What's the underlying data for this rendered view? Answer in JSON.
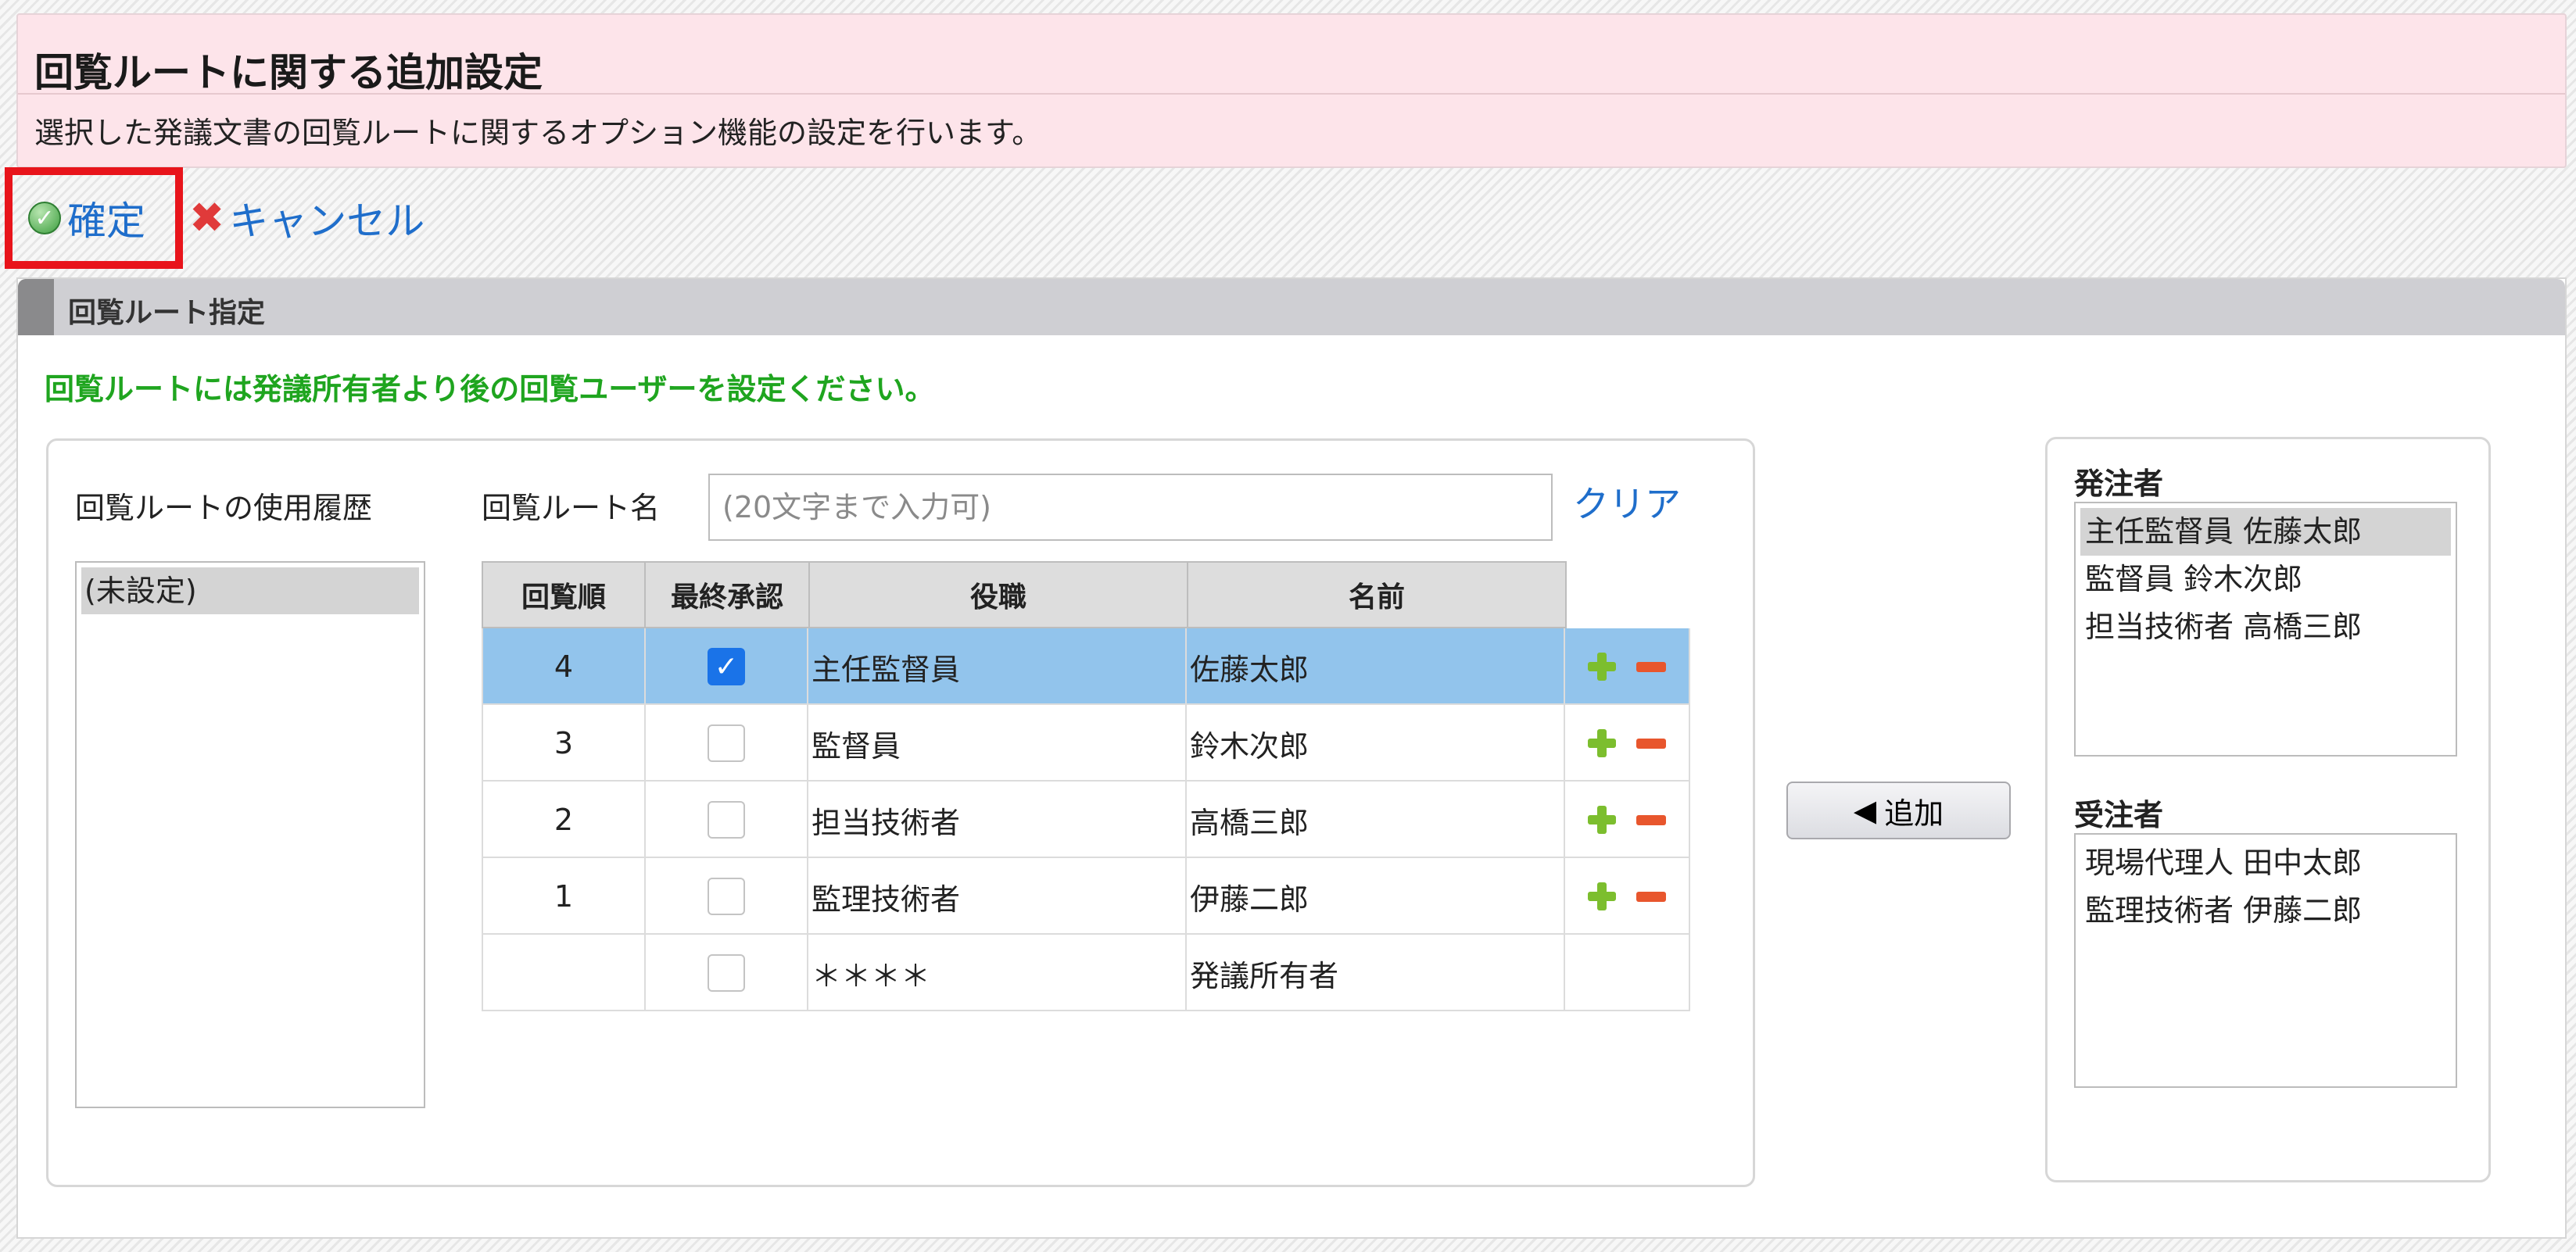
{
  "header": {
    "title": "回覧ルートに関する追加設定",
    "description": "選択した発議文書の回覧ルートに関するオプション機能の設定を行います。"
  },
  "toolbar": {
    "confirm_label": "確定",
    "cancel_label": "キャンセル"
  },
  "section": {
    "title": "回覧ルート指定",
    "notice": "回覧ルートには発議所有者より後の回覧ユーザーを設定ください。",
    "notice_color": "#1fa51f"
  },
  "history": {
    "label": "回覧ルートの使用履歴",
    "items": [
      "(未設定)"
    ]
  },
  "route_name": {
    "label": "回覧ルート名",
    "placeholder": "(20文字まで入力可)",
    "value": "",
    "clear_label": "クリア"
  },
  "table": {
    "headers": [
      "回覧順",
      "最終承認",
      "役職",
      "名前"
    ],
    "rows": [
      {
        "order": "4",
        "final": true,
        "role": "主任監督員",
        "name": "佐藤太郎",
        "selected": true,
        "actions": true
      },
      {
        "order": "3",
        "final": false,
        "role": "監督員",
        "name": "鈴木次郎",
        "selected": false,
        "actions": true
      },
      {
        "order": "2",
        "final": false,
        "role": "担当技術者",
        "name": "高橋三郎",
        "selected": false,
        "actions": true
      },
      {
        "order": "1",
        "final": false,
        "role": "監理技術者",
        "name": "伊藤二郎",
        "selected": false,
        "actions": true
      },
      {
        "order": "",
        "final": false,
        "role": "＊＊＊＊",
        "name": "発議所有者",
        "selected": false,
        "actions": false
      }
    ]
  },
  "add_button": {
    "arrow": "◀",
    "label": "追加"
  },
  "orderer": {
    "label": "発注者",
    "items": [
      "主任監督員 佐藤太郎",
      "監督員 鈴木次郎",
      "担当技術者 高橋三郎"
    ],
    "selected_index": 0
  },
  "contractor": {
    "label": "受注者",
    "items": [
      "現場代理人 田中太郎",
      "監理技術者 伊藤二郎"
    ]
  },
  "colors": {
    "header_bg": "#fde4ea",
    "link": "#1f6ecb",
    "highlight_border": "#e8141b",
    "selected_row": "#92c4ec",
    "add_icon": "#7cbe2e",
    "remove_icon": "#e8562d"
  }
}
